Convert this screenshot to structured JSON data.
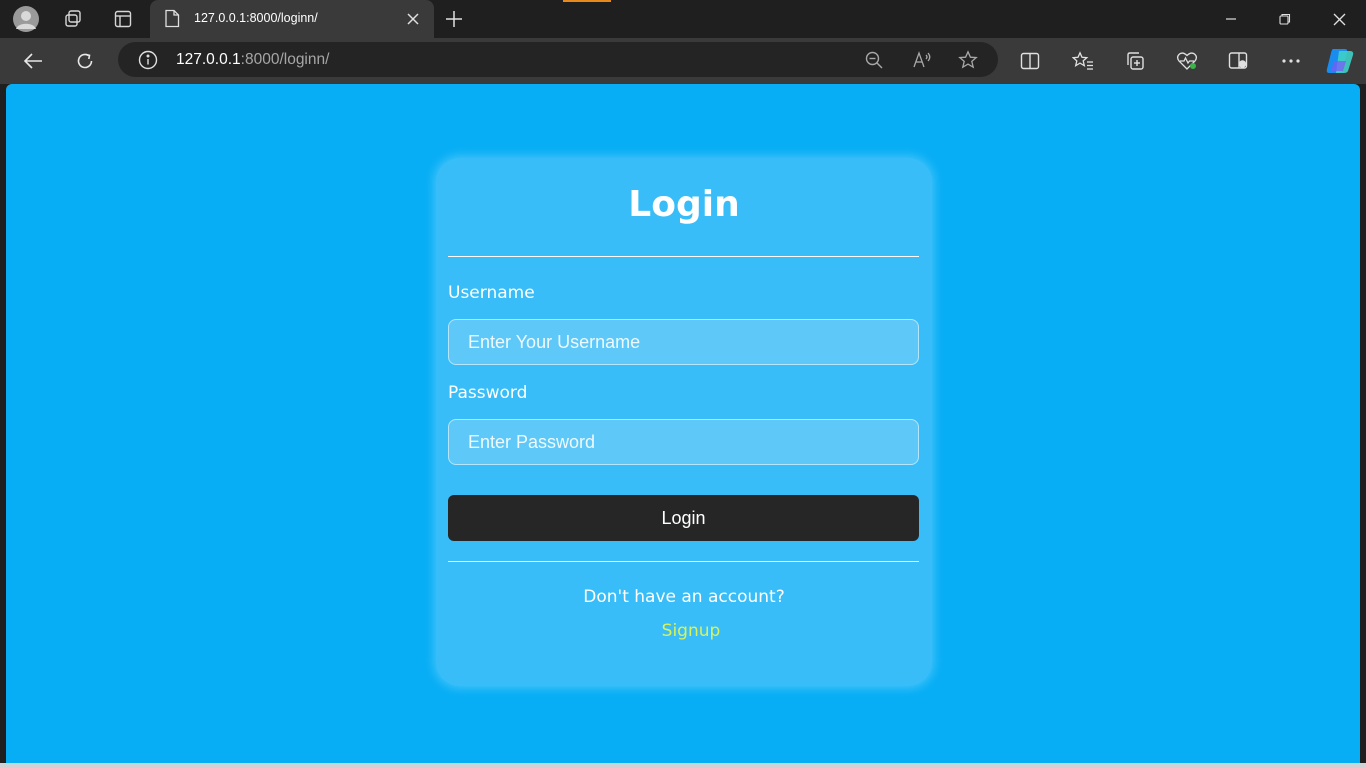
{
  "browser": {
    "tab_title": "127.0.0.1:8000/loginn/",
    "address": {
      "host": "127.0.0.1",
      "rest": ":8000/loginn/"
    },
    "accent_color": "#e8891e"
  },
  "page": {
    "background_color": "#08aef5",
    "card_color": "#38bdf8",
    "title": "Login",
    "username_label": "Username",
    "username_placeholder": "Enter Your Username",
    "password_label": "Password",
    "password_placeholder": "Enter Password",
    "login_button": "Login",
    "no_account_text": "Don't have an account?",
    "signup_link": "Signup",
    "signup_color": "#d9f25b"
  }
}
